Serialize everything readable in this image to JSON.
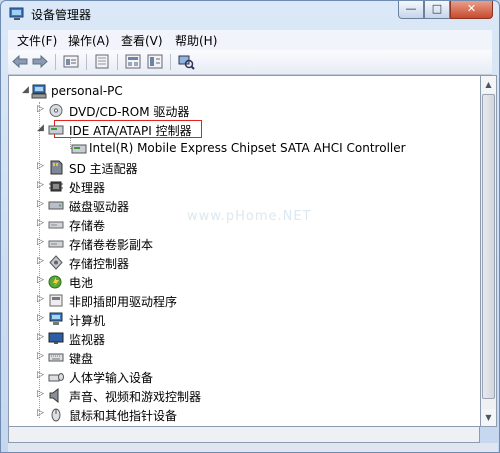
{
  "window": {
    "title": "设备管理器",
    "minimize_glyph": "—",
    "maximize_glyph": "□",
    "close_glyph": "✕"
  },
  "menu": {
    "file": "文件(F)",
    "action": "操作(A)",
    "view": "查看(V)",
    "help": "帮助(H)"
  },
  "toolbar": {
    "buttons": [
      "back-arrow-icon",
      "forward-arrow-icon",
      "properties-icon",
      "help-icon",
      "update-icon",
      "scan-hardware-icon"
    ]
  },
  "tree": {
    "root": "personal-PC",
    "items": [
      "DVD/CD-ROM 驱动器",
      "IDE ATA/ATAPI 控制器",
      "Intel(R) Mobile Express Chipset SATA AHCI Controller",
      "SD 主适配器",
      "处理器",
      "磁盘驱动器",
      "存储卷",
      "存储卷卷影副本",
      "存储控制器",
      "电池",
      "非即插即用驱动程序",
      "计算机",
      "监视器",
      "键盘",
      "人体学输入设备",
      "声音、视频和游戏控制器",
      "鼠标和其他指针设备"
    ],
    "expand_glyph": "▷",
    "collapse_glyph": "◢"
  },
  "watermark": "www.pHome.NET",
  "colors": {
    "highlight_border": "#e0241e",
    "title_bar": "#c5d7ef",
    "close_button": "#c74a2e"
  }
}
